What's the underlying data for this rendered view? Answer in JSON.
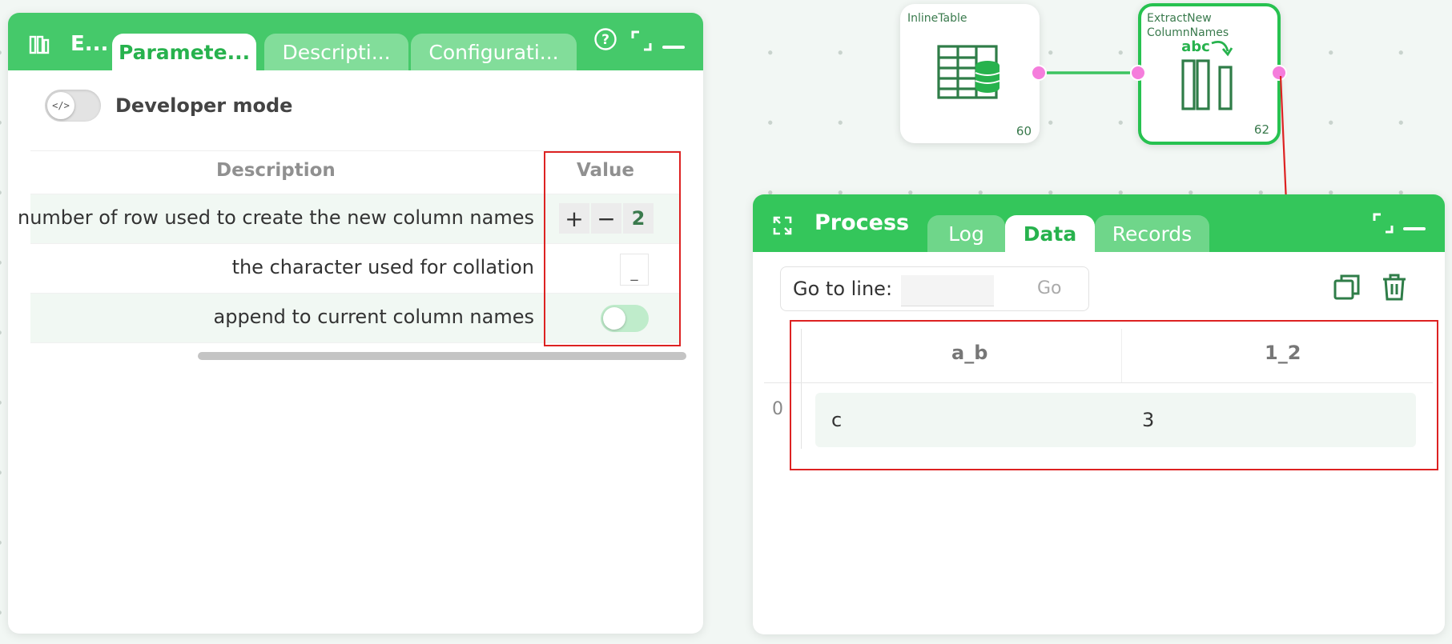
{
  "param_panel": {
    "title": "E...",
    "tabs": [
      {
        "label": "Paramete...",
        "active": true
      },
      {
        "label": "Descripti...",
        "active": false
      },
      {
        "label": "Configurati...",
        "active": false
      }
    ],
    "developer_mode": {
      "label": "Developer mode",
      "toggle_icon": "</>",
      "enabled": false
    },
    "table": {
      "headers": {
        "description": "Description",
        "value": "Value"
      },
      "rows": [
        {
          "description": "number of row used to create the new column names",
          "type": "stepper",
          "value": "2",
          "plus": "+",
          "minus": "−"
        },
        {
          "description": "the character used for collation",
          "type": "text",
          "value": "_"
        },
        {
          "description": "append to current column names",
          "type": "toggle",
          "enabled": false
        }
      ]
    }
  },
  "graph": {
    "nodes": [
      {
        "title": "InlineTable",
        "number": "60",
        "icon": "table-database-icon"
      },
      {
        "title": "ExtractNew\nColumnNames",
        "number": "62",
        "icon": "extract-column-names-icon",
        "icon_text": "abc",
        "selected": true
      }
    ]
  },
  "process_panel": {
    "title": "Process",
    "tabs": [
      {
        "label": "Log",
        "active": false
      },
      {
        "label": "Data",
        "active": true
      },
      {
        "label": "Records",
        "active": false
      }
    ],
    "goto": {
      "label": "Go to line:",
      "value": "",
      "button": "Go"
    },
    "data_table": {
      "columns": [
        "a_b",
        "1_2"
      ],
      "rows": [
        {
          "index": "0",
          "cells": [
            "c",
            "3"
          ]
        }
      ]
    }
  },
  "colors": {
    "header_green": "#45c96a",
    "process_header_green": "#34c65b",
    "accent_green": "#27b24d",
    "port_pink": "#f57ddc",
    "annotation_red": "#dd2222"
  }
}
